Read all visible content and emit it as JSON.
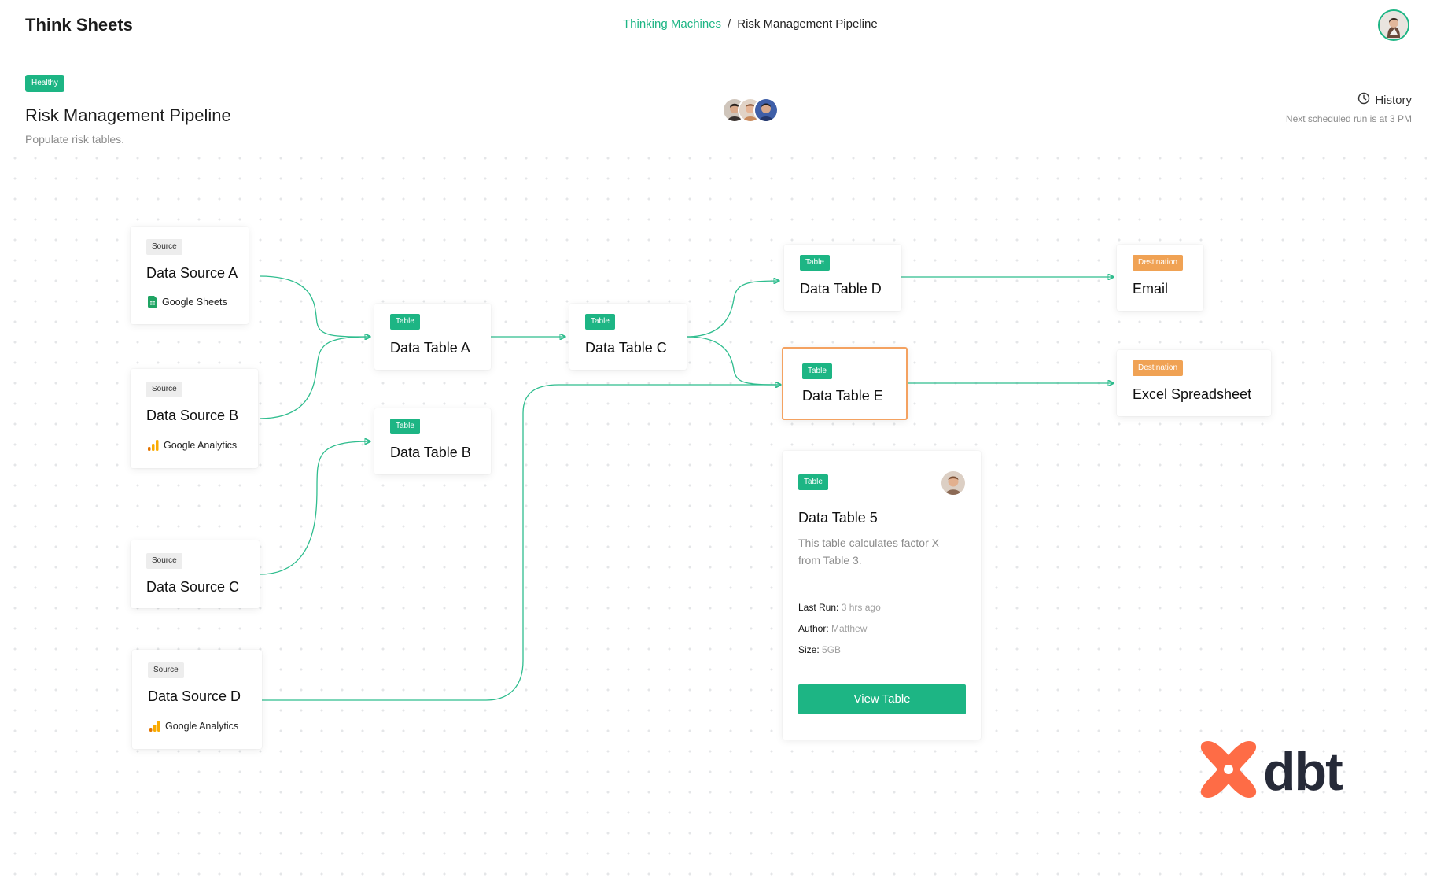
{
  "app": {
    "title": "Think Sheets"
  },
  "breadcrumb": {
    "org": "Thinking Machines",
    "separator": "/",
    "page": "Risk Management Pipeline"
  },
  "pipeline": {
    "status": "Healthy",
    "title": "Risk Management Pipeline",
    "subtitle": "Populate risk tables.",
    "history_label": "History",
    "next_run": "Next scheduled run is at 3 PM"
  },
  "nodes": {
    "source_a": {
      "tag": "Source",
      "title": "Data Source A",
      "integration": "Google Sheets"
    },
    "source_b": {
      "tag": "Source",
      "title": "Data Source B",
      "integration": "Google Analytics"
    },
    "source_c": {
      "tag": "Source",
      "title": "Data Source C"
    },
    "source_d": {
      "tag": "Source",
      "title": "Data Source D",
      "integration": "Google Analytics"
    },
    "table_a": {
      "tag": "Table",
      "title": "Data Table A"
    },
    "table_b": {
      "tag": "Table",
      "title": "Data Table B"
    },
    "table_c": {
      "tag": "Table",
      "title": "Data Table C"
    },
    "table_d": {
      "tag": "Table",
      "title": "Data Table D"
    },
    "table_e": {
      "tag": "Table",
      "title": "Data Table E"
    },
    "dest_email": {
      "tag": "Destination",
      "title": "Email"
    },
    "dest_excel": {
      "tag": "Destination",
      "title": "Excel Spreadsheet"
    }
  },
  "detail": {
    "tag": "Table",
    "title": "Data Table 5",
    "description": "This table calculates factor X from Table 3.",
    "last_run_label": "Last Run:",
    "last_run_value": "3 hrs ago",
    "author_label": "Author:",
    "author_value": "Matthew",
    "size_label": "Size:",
    "size_value": "5GB",
    "button": "View Table"
  },
  "brand": {
    "logo_text": "dbt"
  },
  "colors": {
    "accent": "#1db584",
    "destination": "#f0a254",
    "selected_border": "#f4a261",
    "logo_mark": "#fe6c46"
  },
  "icons": [
    "user-avatar",
    "clock-icon",
    "google-sheets-icon",
    "google-analytics-icon",
    "dbt-logo-mark"
  ]
}
